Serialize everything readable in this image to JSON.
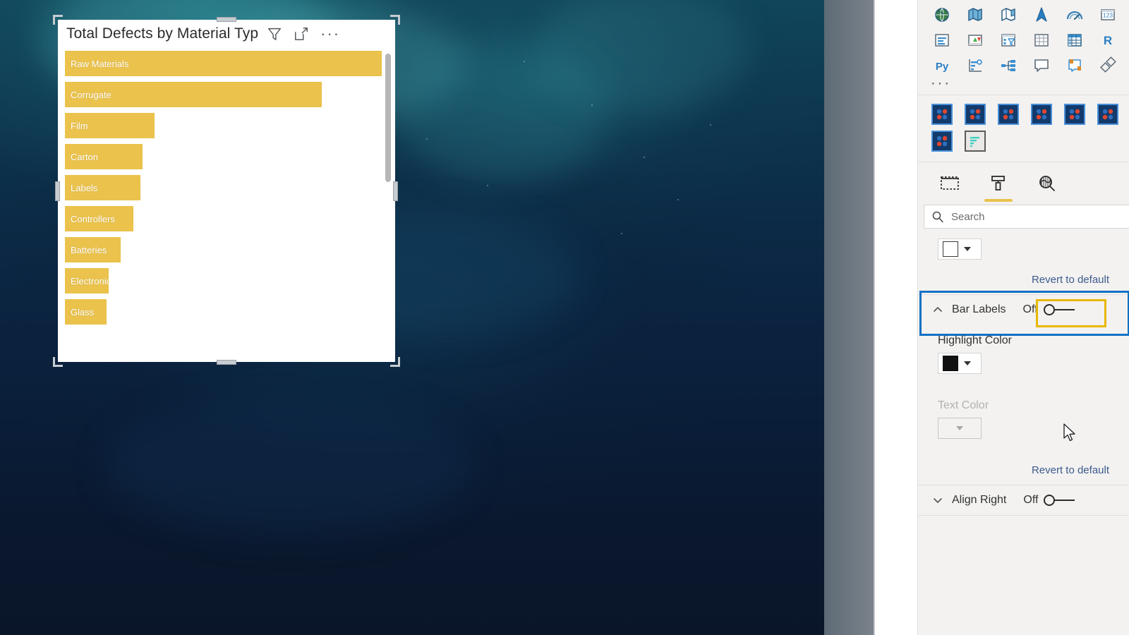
{
  "visual": {
    "title": "Total Defects by Material Typ",
    "icons": {
      "filter": "filter-icon",
      "focus": "focus-mode-icon",
      "more": "more-options-icon"
    },
    "more_label": "···"
  },
  "chart_data": {
    "type": "bar",
    "title": "Total Defects by Material Typ",
    "orientation": "horizontal",
    "categories": [
      "Raw Materials",
      "Corrugate",
      "Film",
      "Carton",
      "Labels",
      "Controllers",
      "Batteries",
      "Electronics",
      "Glass"
    ],
    "values": [
      328,
      266,
      93,
      80,
      78,
      71,
      58,
      45,
      43
    ],
    "bar_color": "#eac24c",
    "label_color": "#ffffff",
    "xlabel": "",
    "ylabel": "",
    "grid": false,
    "legend": "none",
    "axis_visible": false,
    "xlim": [
      0,
      330
    ]
  },
  "visualizations_gallery": {
    "icons": [
      "globe-map-icon",
      "filled-map-icon",
      "shape-map-icon",
      "arcgis-map-icon",
      "gauge-icon",
      "card-number-icon",
      "multi-row-card-icon",
      "kpi-icon",
      "slicer-icon",
      "table-icon",
      "matrix-icon",
      "r-script-visual-icon",
      "python-visual-icon",
      "key-influencers-icon",
      "decomposition-tree-icon",
      "q-and-a-icon",
      "smart-narrative-icon",
      "paginated-report-icon"
    ],
    "more_label": "···",
    "custom_visuals": [
      "custom-visual-icon",
      "custom-visual-icon",
      "custom-visual-icon",
      "custom-visual-icon",
      "custom-visual-icon",
      "custom-visual-icon",
      "custom-visual-icon",
      "selected-bar-chart-visual-icon"
    ]
  },
  "format_pane": {
    "tabs": [
      {
        "name": "fields-tab",
        "icon": "fields-dotted-rectangle-icon",
        "active": false
      },
      {
        "name": "format-tab",
        "icon": "paint-roller-icon",
        "active": true
      },
      {
        "name": "analytics-tab",
        "icon": "magnifier-chart-icon",
        "active": false
      }
    ],
    "accent_color": "#eac24c",
    "search": {
      "placeholder": "Search",
      "value": "",
      "icon": "search-icon"
    },
    "top_color_control": {
      "swatch_color": "#ffffff",
      "dropdown_icon": "chevron-down-icon"
    },
    "revert_label": "Revert to default",
    "sections": {
      "bar_labels": {
        "title": "Bar Labels",
        "expand_icon": "chevron-up-icon",
        "toggle_state": "Off",
        "highlighted": true,
        "highlight_color": "#1271c4",
        "toggle_highlight_color": "#e8b800"
      },
      "highlight_color": {
        "label": "Highlight Color",
        "swatch_color": "#111111",
        "dropdown_icon": "chevron-down-icon",
        "disabled": false
      },
      "text_color": {
        "label": "Text Color",
        "swatch_color": "",
        "dropdown_icon": "chevron-down-icon",
        "disabled": true
      },
      "revert_label": "Revert to default",
      "align_right": {
        "title": "Align Right",
        "expand_icon": "chevron-down-icon",
        "toggle_state": "Off"
      }
    }
  },
  "cursor": {
    "icon": "mouse-pointer-icon"
  }
}
